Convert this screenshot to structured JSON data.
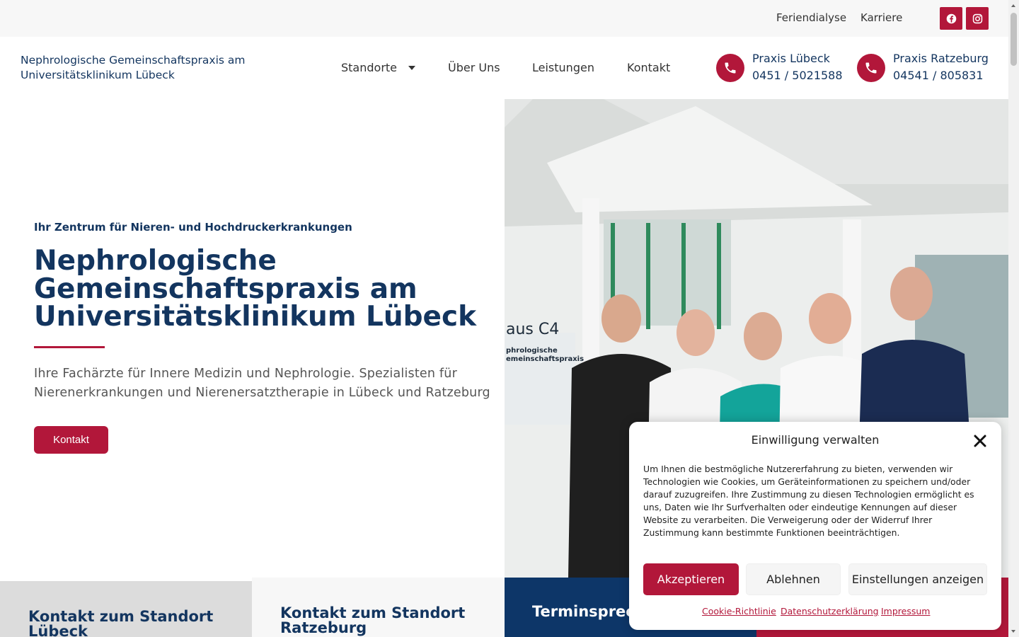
{
  "topbar": {
    "links": [
      "Feriendialyse",
      "Karriere"
    ],
    "social": [
      "facebook-icon",
      "instagram-icon"
    ]
  },
  "header": {
    "logo_text": "Nephrologische Gemeinschaftspraxis am Universitätsklinikum Lübeck",
    "nav": [
      "Standorte",
      "Über Uns",
      "Leistungen",
      "Kontakt"
    ],
    "phones": [
      {
        "title": "Praxis Lübeck",
        "number": "0451 / 5021588"
      },
      {
        "title": "Praxis Ratzeburg",
        "number": "04541 / 805831"
      }
    ]
  },
  "hero": {
    "subtitle": "Ihr Zentrum für Nieren- und Hochdruckerkrankungen",
    "title": "Nephrologische Gemeinschaftspraxis am Universitätsklinikum Lübeck",
    "description": "Ihre Fachärzte für Innere Medizin und Nephrologie. Spezialisten für Nierenerkrankungen und Nierenersatztherapie in Lübeck und Ratzeburg",
    "button": "Kontakt"
  },
  "photo": {
    "sign_lines": [
      "aus C4",
      "phrologische",
      "emeinschaftspraxis"
    ]
  },
  "cards": [
    {
      "title": "Kontakt zum Standort Lübeck"
    },
    {
      "title": "Kontakt zum Standort Ratzeburg"
    },
    {
      "title": "Terminsprech"
    },
    {
      "title": ""
    }
  ],
  "consent": {
    "title": "Einwilligung verwalten",
    "text": "Um Ihnen die bestmögliche Nutzererfahrung zu bieten, verwenden wir Technologien wie Cookies, um Geräteinformationen zu speichern und/oder darauf zuzugreifen. Ihre Zustimmung zu diesen Technologien ermöglicht es uns, Daten wie Ihr Surfverhalten oder eindeutige Kennungen auf dieser Website zu verarbeiten. Die Verweigerung oder der Widerruf Ihrer Zustimmung kann bestimmte Funktionen beeinträchtigen.",
    "accept": "Akzeptieren",
    "deny": "Ablehnen",
    "settings": "Einstellungen anzeigen",
    "links": [
      "Cookie-Richtlinie",
      "Datenschutzerklärung",
      "Impressum"
    ]
  },
  "colors": {
    "brand_red": "#b2173a",
    "brand_navy": "#13355f",
    "card_navy": "#0d3668"
  }
}
